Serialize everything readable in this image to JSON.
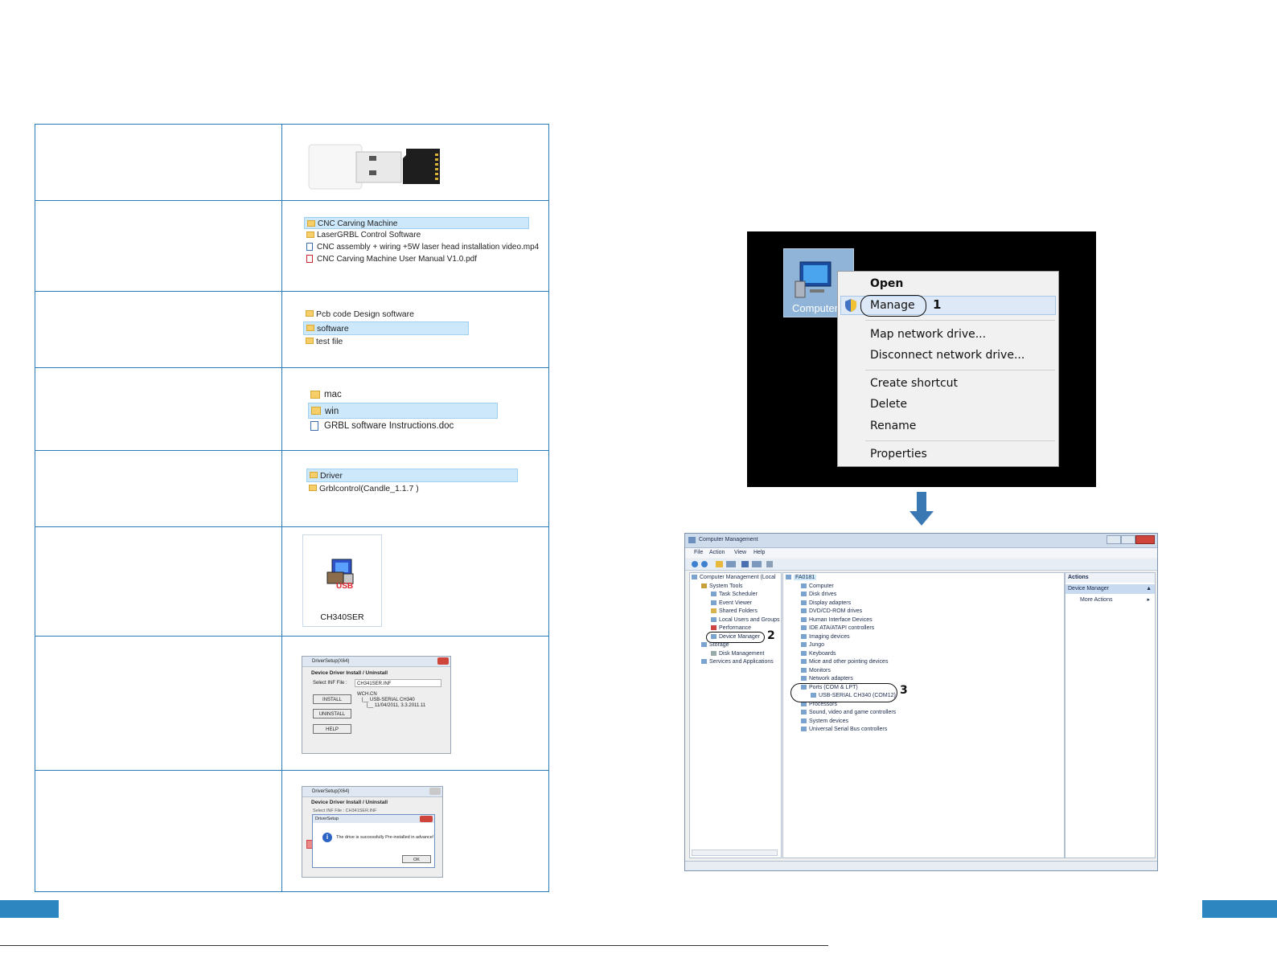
{
  "rows": [
    {
      "type": "hardware"
    },
    {
      "type": "list",
      "items": [
        {
          "label": "CNC Carving Machine",
          "icon": "folder",
          "selected": true
        },
        {
          "label": "LaserGRBL Control Software",
          "icon": "folder",
          "selected": false
        },
        {
          "label": "CNC assembly + wiring +5W laser head installation video.mp4",
          "icon": "video",
          "selected": false
        },
        {
          "label": "CNC Carving Machine User Manual V1.0.pdf",
          "icon": "pdf",
          "selected": false
        }
      ]
    },
    {
      "type": "list",
      "items": [
        {
          "label": "Pcb code Design software",
          "icon": "folder",
          "selected": false
        },
        {
          "label": "software",
          "icon": "folder",
          "selected": true
        },
        {
          "label": "test file",
          "icon": "folder",
          "selected": false
        }
      ]
    },
    {
      "type": "list",
      "items": [
        {
          "label": "mac",
          "icon": "folder",
          "selected": false
        },
        {
          "label": "win",
          "icon": "folder",
          "selected": true
        },
        {
          "label": "GRBL software Instructions.doc",
          "icon": "doc",
          "selected": false
        }
      ]
    },
    {
      "type": "list",
      "items": [
        {
          "label": "Driver",
          "icon": "folder",
          "selected": true
        },
        {
          "label": "Grblcontrol(Candle_1.1.7 )",
          "icon": "folder",
          "selected": false
        }
      ]
    }
  ],
  "ch340": {
    "label": "CH340SER",
    "badge": "USB"
  },
  "driver_setup": {
    "title": "DriverSetup(X64)",
    "heading": "Device Driver Install / Uninstall",
    "select_label": "Select INF File :",
    "select_value": "CH341SER.INF",
    "install": "INSTALL",
    "uninstall": "UNINSTALL",
    "help": "HELP",
    "info_line1": "WCH.CN",
    "info_line2": "|__ USB-SERIAL CH340",
    "info_line3": "|__ 11/04/2011, 3.3.2011.11"
  },
  "driver_success": {
    "title": "DriverSetup(X64)",
    "heading": "Device Driver Install / Uninstall",
    "select_partial": "Select INF File : CH341SER.INF",
    "msg_title": "DriverSetup",
    "message": "The drive is successfully Pre-installed in advance!",
    "ok": "OK"
  },
  "context_menu": {
    "desktop_icon_label": "Computer",
    "items": [
      "Open",
      "Manage",
      "Map network drive...",
      "Disconnect network drive...",
      "Create shortcut",
      "Delete",
      "Rename",
      "Properties"
    ],
    "callout_1": "1"
  },
  "comp_mgmt": {
    "title": "Computer Management",
    "menu": [
      "File",
      "Action",
      "View",
      "Help"
    ],
    "tree": [
      "Computer Management (Local",
      "System Tools",
      "Task Scheduler",
      "Event Viewer",
      "Shared Folders",
      "Local Users and Groups",
      "Performance",
      "Device Manager",
      "Storage",
      "Disk Management",
      "Services and Applications"
    ],
    "root": "FA0181",
    "devices": [
      "Computer",
      "Disk drives",
      "Display adapters",
      "DVD/CD-ROM drives",
      "Human Interface Devices",
      "IDE ATA/ATAPI controllers",
      "Imaging devices",
      "Jungo",
      "Keyboards",
      "Mice and other pointing devices",
      "Monitors",
      "Network adapters",
      "Ports (COM & LPT)",
      "USB-SERIAL CH340 (COM12)",
      "Processors",
      "Sound, video and game controllers",
      "System devices",
      "Universal Serial Bus controllers"
    ],
    "actions_title": "Actions",
    "actions_section": "Device Manager",
    "more_actions": "More Actions",
    "callout_2": "2",
    "callout_3": "3"
  },
  "colors": {
    "accent": "#2b7bb9",
    "select": "#cde8fa",
    "footer_tab": "#2e86c1"
  }
}
